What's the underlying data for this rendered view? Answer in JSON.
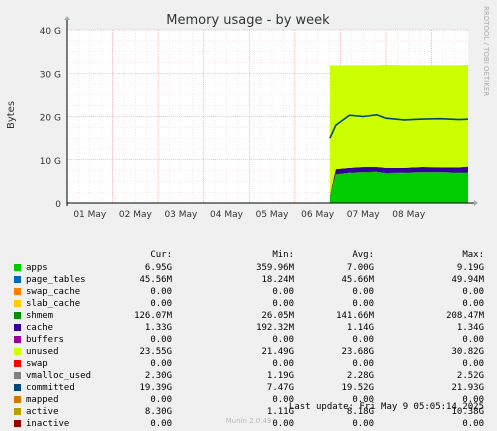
{
  "colors": {
    "background": "#f0f0f0",
    "plot_bg": "#ffffff",
    "grid_major": "#e6a0a0",
    "grid_minor": "#f0c8c8",
    "axis": "#000000"
  },
  "watermark": "RRDTOOL / TOBI OETIKER",
  "chart_data": {
    "type": "area",
    "title": "Memory usage - by week",
    "ylabel": "Bytes",
    "ylim": [
      0,
      40
    ],
    "yunit": "G",
    "yticks": [
      "0",
      "10 G",
      "20 G",
      "30 G",
      "40 G"
    ],
    "ytick_values": [
      0,
      10,
      20,
      30,
      40
    ],
    "xticks": [
      "01 May",
      "02 May",
      "03 May",
      "04 May",
      "05 May",
      "06 May",
      "07 May",
      "08 May"
    ],
    "xlim_days": [
      0,
      8.8
    ],
    "grid": true,
    "data_start_day": 5.77,
    "data_points_day": [
      5.77,
      5.9,
      6.2,
      6.5,
      6.8,
      7.0,
      7.4,
      7.8,
      8.2,
      8.6,
      8.8
    ],
    "series": [
      {
        "name": "apps",
        "color": "#00cc00",
        "values": [
          1.5,
          6.5,
          6.9,
          7.0,
          7.1,
          6.8,
          6.9,
          7.0,
          7.0,
          6.9,
          6.95
        ]
      },
      {
        "name": "shmem",
        "color": "#008f00",
        "values": [
          0.05,
          0.12,
          0.13,
          0.13,
          0.13,
          0.13,
          0.13,
          0.13,
          0.13,
          0.13,
          0.13
        ]
      },
      {
        "name": "cache",
        "color": "#330099",
        "values": [
          0.2,
          1.2,
          1.1,
          1.2,
          1.1,
          1.2,
          1.1,
          1.2,
          1.1,
          1.2,
          1.33
        ]
      },
      {
        "name": "unused",
        "color": "#ccff00",
        "values": [
          30.1,
          24.0,
          23.7,
          23.5,
          23.5,
          23.8,
          23.7,
          23.5,
          23.6,
          23.6,
          23.55
        ]
      },
      {
        "name": "committed",
        "color": "#00457a",
        "line": true,
        "values": [
          15.0,
          18.0,
          20.3,
          20.0,
          20.4,
          19.6,
          19.2,
          19.4,
          19.5,
          19.3,
          19.39
        ]
      }
    ],
    "total": 32.2
  },
  "legend": {
    "headers": {
      "cur": "Cur:",
      "min": "Min:",
      "avg": "Avg:",
      "max": "Max:"
    },
    "rows": [
      {
        "name": "apps",
        "color": "#00cc00",
        "cur": "6.95G",
        "min": "359.96M",
        "avg": "7.00G",
        "max": "9.19G"
      },
      {
        "name": "page_tables",
        "color": "#0066b3",
        "cur": "45.56M",
        "min": "18.24M",
        "avg": "45.66M",
        "max": "49.94M"
      },
      {
        "name": "swap_cache",
        "color": "#ff8000",
        "cur": "0.00",
        "min": "0.00",
        "avg": "0.00",
        "max": "0.00"
      },
      {
        "name": "slab_cache",
        "color": "#ffcc00",
        "cur": "0.00",
        "min": "0.00",
        "avg": "0.00",
        "max": "0.00"
      },
      {
        "name": "shmem",
        "color": "#008f00",
        "cur": "126.07M",
        "min": "26.05M",
        "avg": "141.66M",
        "max": "208.47M"
      },
      {
        "name": "cache",
        "color": "#330099",
        "cur": "1.33G",
        "min": "192.32M",
        "avg": "1.14G",
        "max": "1.34G"
      },
      {
        "name": "buffers",
        "color": "#990099",
        "cur": "0.00",
        "min": "0.00",
        "avg": "0.00",
        "max": "0.00"
      },
      {
        "name": "unused",
        "color": "#ccff00",
        "cur": "23.55G",
        "min": "21.49G",
        "avg": "23.68G",
        "max": "30.82G"
      },
      {
        "name": "swap",
        "color": "#ff0000",
        "cur": "0.00",
        "min": "0.00",
        "avg": "0.00",
        "max": "0.00"
      },
      {
        "name": "vmalloc_used",
        "color": "#808080",
        "cur": "2.30G",
        "min": "1.19G",
        "avg": "2.28G",
        "max": "2.52G"
      },
      {
        "name": "committed",
        "color": "#00457a",
        "cur": "19.39G",
        "min": "7.47G",
        "avg": "19.52G",
        "max": "21.93G"
      },
      {
        "name": "mapped",
        "color": "#cc7a00",
        "cur": "0.00",
        "min": "0.00",
        "avg": "0.00",
        "max": "0.00"
      },
      {
        "name": "active",
        "color": "#b8a000",
        "cur": "8.30G",
        "min": "1.11G",
        "avg": "8.18G",
        "max": "10.38G"
      },
      {
        "name": "inactive",
        "color": "#990000",
        "cur": "0.00",
        "min": "0.00",
        "avg": "0.00",
        "max": "0.00"
      }
    ]
  },
  "last_update": "Last update: Fri May  9 05:05:14 2025",
  "footer": "Munin 2.0.49"
}
